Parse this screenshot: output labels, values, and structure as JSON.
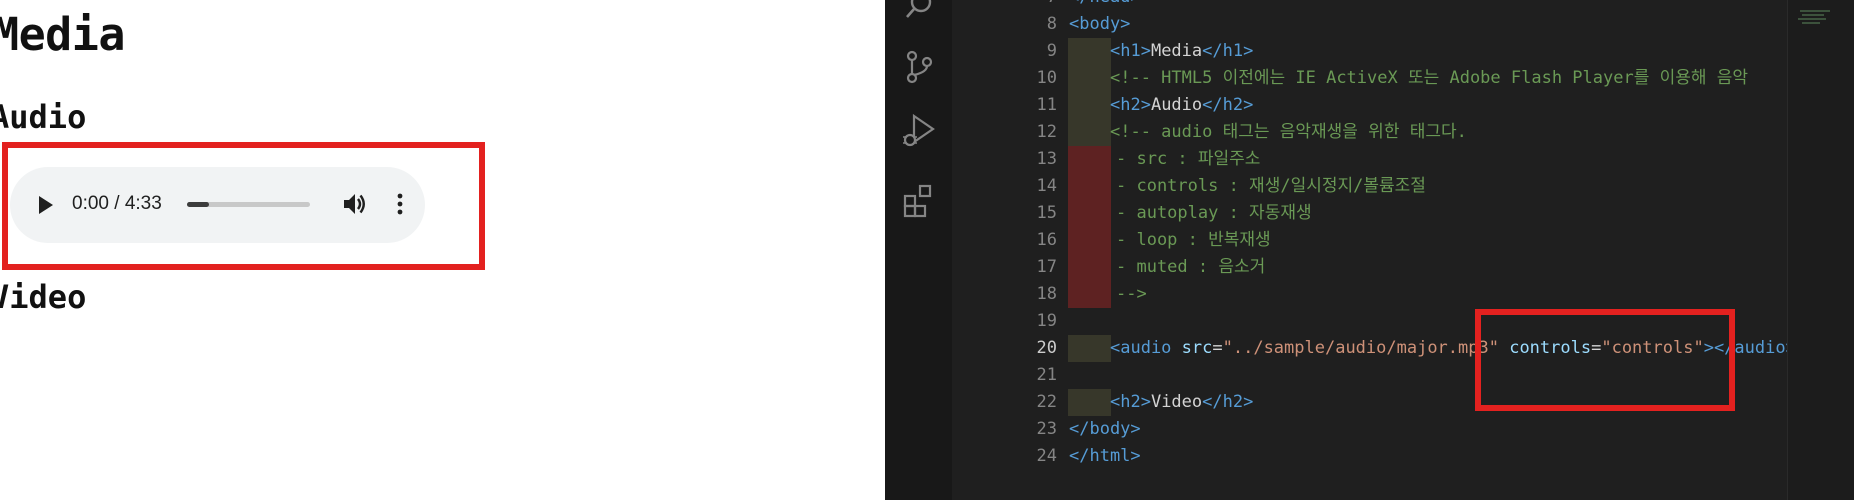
{
  "preview": {
    "h1": "Media",
    "h2_audio": "Audio",
    "h2_video": "Video",
    "player": {
      "time": "0:00 / 4:33",
      "progress_fraction": 0.18
    }
  },
  "editor": {
    "lines": [
      {
        "num": "7",
        "parts": [
          {
            "t": "</head>",
            "c": "tag"
          }
        ]
      },
      {
        "num": "8",
        "parts": [
          {
            "t": "<body>",
            "c": "tag"
          }
        ]
      },
      {
        "num": "9",
        "parts": [
          {
            "t": "<h1>",
            "c": "tag"
          },
          {
            "t": "Media",
            "c": "white"
          },
          {
            "t": "</h1>",
            "c": "tag"
          }
        ]
      },
      {
        "num": "10",
        "parts": [
          {
            "t": "<!-- HTML5 이전에는 IE ActiveX 또는 Adobe Flash Player를 이용해 음악",
            "c": "comment"
          }
        ]
      },
      {
        "num": "11",
        "parts": [
          {
            "t": "<h2>",
            "c": "tag"
          },
          {
            "t": "Audio",
            "c": "white"
          },
          {
            "t": "</h2>",
            "c": "tag"
          }
        ]
      },
      {
        "num": "12",
        "parts": [
          {
            "t": "<!-- audio 태그는 음악재생을 위한 태그다.",
            "c": "comment"
          }
        ]
      },
      {
        "num": "13",
        "parts": [
          {
            "t": "- src : 파일주소",
            "c": "comment"
          }
        ]
      },
      {
        "num": "14",
        "parts": [
          {
            "t": "- controls : 재생/일시정지/볼륨조절",
            "c": "comment"
          }
        ]
      },
      {
        "num": "15",
        "parts": [
          {
            "t": "- autoplay : 자동재생",
            "c": "comment"
          }
        ]
      },
      {
        "num": "16",
        "parts": [
          {
            "t": "- loop : 반복재생",
            "c": "comment"
          }
        ]
      },
      {
        "num": "17",
        "parts": [
          {
            "t": "- muted : 음소거",
            "c": "comment"
          }
        ]
      },
      {
        "num": "18",
        "parts": [
          {
            "t": "-->",
            "c": "comment"
          }
        ]
      },
      {
        "num": "19",
        "parts": []
      },
      {
        "num": "20",
        "parts": [
          {
            "t": "<audio",
            "c": "tag"
          },
          {
            "t": " src",
            "c": "attr"
          },
          {
            "t": "=",
            "c": "white"
          },
          {
            "t": "\"../sample/audio/major.mp3\"",
            "c": "str"
          },
          {
            "t": " controls",
            "c": "attr"
          },
          {
            "t": "=",
            "c": "white"
          },
          {
            "t": "\"controls\"",
            "c": "str"
          },
          {
            "t": "></audio>",
            "c": "tag"
          }
        ]
      },
      {
        "num": "21",
        "parts": []
      },
      {
        "num": "22",
        "parts": [
          {
            "t": "<h2>",
            "c": "tag"
          },
          {
            "t": "Video",
            "c": "white"
          },
          {
            "t": "</h2>",
            "c": "tag"
          }
        ]
      },
      {
        "num": "23",
        "parts": [
          {
            "t": "</body>",
            "c": "tag"
          }
        ]
      },
      {
        "num": "24",
        "parts": [
          {
            "t": "</html>",
            "c": "tag"
          }
        ]
      }
    ],
    "active_line": "20",
    "icons": [
      "search-icon",
      "source-control-icon",
      "run-debug-icon",
      "extensions-icon"
    ]
  },
  "colors": {
    "annotation_red": "#e3211f",
    "editor_bg": "#1f1f1f",
    "player_bg": "#f1f3f4"
  }
}
